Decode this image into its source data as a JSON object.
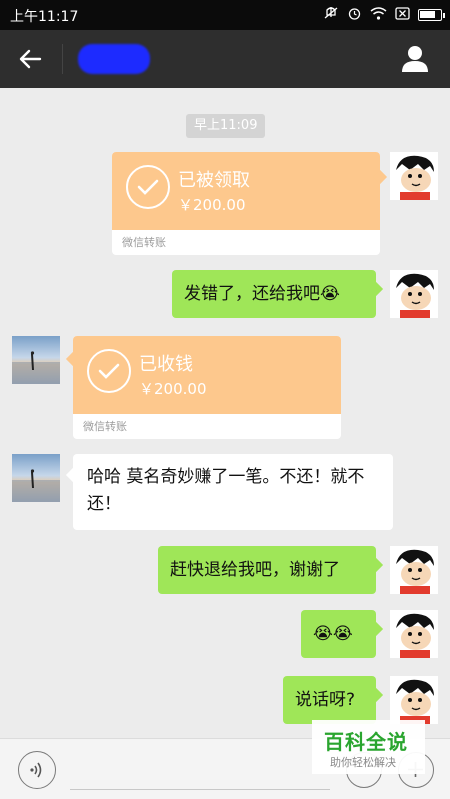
{
  "status_bar": {
    "time": "上午11:17",
    "icons": [
      "mute-icon",
      "alarm-icon",
      "wifi-icon",
      "no-sim-icon",
      "battery-icon"
    ],
    "battery_level": 0.85
  },
  "nav": {
    "back_icon": "back-arrow-icon",
    "contact_name_redacted": "",
    "profile_icon": "person-icon"
  },
  "chat": {
    "timestamp": "早上11:09",
    "messages": [
      {
        "from": "me",
        "type": "transfer",
        "status": "已被领取",
        "amount": "￥200.00",
        "footer": "微信转账"
      },
      {
        "from": "me",
        "type": "text",
        "text": "发错了，还给我吧😭"
      },
      {
        "from": "other",
        "type": "transfer",
        "status": "已收钱",
        "amount": "￥200.00",
        "footer": "微信转账"
      },
      {
        "from": "other",
        "type": "text",
        "text": "哈哈 莫名奇妙赚了一笔。不还！就不还！"
      },
      {
        "from": "me",
        "type": "text",
        "text": "赶快退给我吧，谢谢了"
      },
      {
        "from": "me",
        "type": "text",
        "text": "😭😭"
      },
      {
        "from": "me",
        "type": "text",
        "text": "说话呀?"
      }
    ]
  },
  "input_bar": {
    "voice_icon": "voice-icon",
    "emoji_icon": "emoji-icon",
    "plus_icon": "plus-icon"
  },
  "watermark": {
    "title": "百科全说",
    "subtitle": "助你轻松解决"
  },
  "colors": {
    "status_bar": "#0b0b0b",
    "nav_bar": "#2e2e2e",
    "chat_bg": "#ececec",
    "bubble_me": "#9fe658",
    "bubble_other": "#ffffff",
    "transfer": "#fdc88d",
    "watermark_green": "#2aa52f"
  }
}
